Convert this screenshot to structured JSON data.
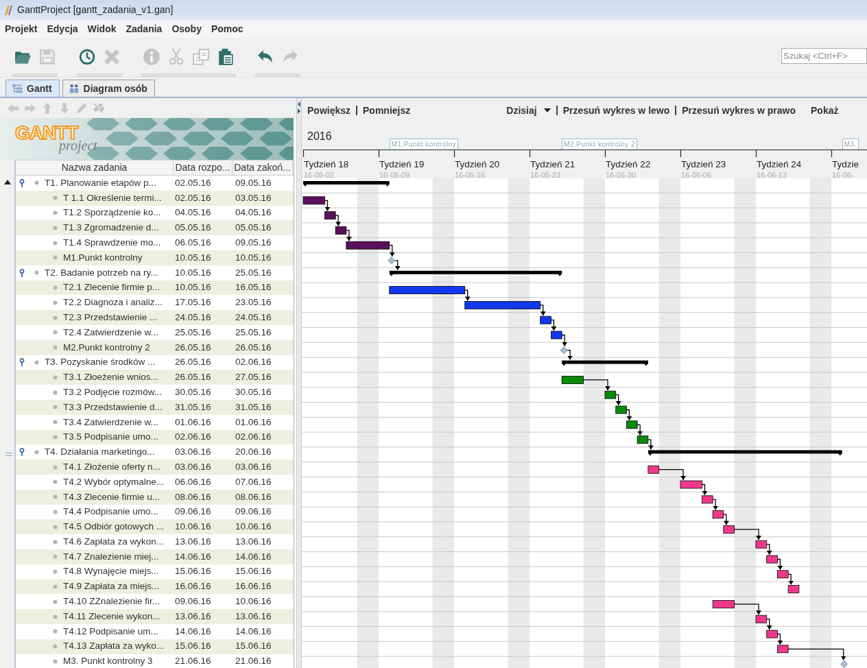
{
  "window": {
    "title": "GanttProject [gantt_zadania_v1.gan]"
  },
  "menu": [
    "Projekt",
    "Edycja",
    "Widok",
    "Zadania",
    "Osoby",
    "Pomoc"
  ],
  "toolbar": {
    "groups": [
      [
        {
          "disabled": false
        },
        {
          "disabled": true
        }
      ],
      [
        {
          "disabled": false
        },
        {
          "disabled": true
        }
      ],
      [
        {
          "disabled": true
        },
        {
          "disabled": true
        },
        {
          "disabled": true
        },
        {
          "disabled": false
        }
      ],
      [
        {
          "disabled": false
        },
        {
          "disabled": true
        }
      ]
    ]
  },
  "search": {
    "placeholder": "Szukaj <Ctrl+F>"
  },
  "tabs": [
    {
      "label": "Gantt",
      "selected": true
    },
    {
      "label": "Diagram osób",
      "selected": false
    }
  ],
  "task_nav": [
    {
      "disabled": true
    },
    {
      "disabled": true
    },
    {
      "disabled": true
    },
    {
      "disabled": true
    },
    {
      "disabled": true
    },
    {
      "disabled": true
    }
  ],
  "logo": {
    "title": "GANTT",
    "subtitle": "project"
  },
  "table": {
    "columns": [
      "Nazwa zadania",
      "Data rozpo...",
      "Data zakoń..."
    ],
    "tasks": [
      {
        "kind": "summary",
        "name": "T1. Planowanie etapów p...",
        "start": "02.05.16",
        "end": "09.05.16",
        "expanded": true,
        "linked": false,
        "children": [
          {
            "kind": "task",
            "name": "T 1.1 Określenie termi...",
            "start": "02.05.16",
            "end": "03.05.16",
            "color": "#5c0f5c",
            "linked": false
          },
          {
            "kind": "task",
            "name": "T1.2 Sporządzenie ko...",
            "start": "04.05.16",
            "end": "04.05.16",
            "color": "#5c0f5c",
            "linked": true
          },
          {
            "kind": "task",
            "name": "T1.3 Zgromadzenie d...",
            "start": "05.05.16",
            "end": "05.05.16",
            "color": "#5c0f5c",
            "linked": true
          },
          {
            "kind": "task",
            "name": "T1.4 Sprawdzenie mo...",
            "start": "06.05.16",
            "end": "09.05.16",
            "color": "#5c0f5c",
            "linked": true
          },
          {
            "kind": "milestone",
            "name": "M1.Punkt kontrolny",
            "start": "10.05.16",
            "end": "10.05.16",
            "linked": true
          }
        ]
      },
      {
        "kind": "summary",
        "name": "T2. Badanie potrzeb na ry...",
        "start": "10.05.16",
        "end": "25.05.16",
        "expanded": true,
        "linked": true,
        "children": [
          {
            "kind": "task",
            "name": "T2.1 Zlecenie firmie p...",
            "start": "10.05.16",
            "end": "16.05.16",
            "color": "#1038f0",
            "linked": false
          },
          {
            "kind": "task",
            "name": "T2.2 Diagnoza i analiz...",
            "start": "17.05.16",
            "end": "23.05.16",
            "color": "#1038f0",
            "linked": true
          },
          {
            "kind": "task",
            "name": "T2.3 Przedstawienie ...",
            "start": "24.05.16",
            "end": "24.05.16",
            "color": "#1038f0",
            "linked": true
          },
          {
            "kind": "task",
            "name": "T2.4 Zatwierdzenie w...",
            "start": "25.05.16",
            "end": "25.05.16",
            "color": "#1038f0",
            "linked": true
          },
          {
            "kind": "milestone",
            "name": "M2.Punkt kontrolny 2",
            "start": "26.05.16",
            "end": "26.05.16",
            "linked": true
          }
        ]
      },
      {
        "kind": "summary",
        "name": "T3. Pozyskanie środków ...",
        "start": "26.05.16",
        "end": "02.06.16",
        "expanded": true,
        "linked": true,
        "children": [
          {
            "kind": "task",
            "name": "T3.1 Złoeżenie wnios...",
            "start": "26.05.16",
            "end": "27.05.16",
            "color": "#0a8c0a",
            "linked": false
          },
          {
            "kind": "task",
            "name": "T3.2 Podjęcie rozmów...",
            "start": "30.05.16",
            "end": "30.05.16",
            "color": "#0a8c0a",
            "linked": true
          },
          {
            "kind": "task",
            "name": "T3.3 Przedstawienie d...",
            "start": "31.05.16",
            "end": "31.05.16",
            "color": "#0a8c0a",
            "linked": true
          },
          {
            "kind": "task",
            "name": "T3.4 Zatwierdzenie w...",
            "start": "01.06.16",
            "end": "01.06.16",
            "color": "#0a8c0a",
            "linked": true
          },
          {
            "kind": "task",
            "name": "T3.5 Podpisanie umo...",
            "start": "02.06.16",
            "end": "02.06.16",
            "color": "#0a8c0a",
            "linked": true
          }
        ]
      },
      {
        "kind": "summary",
        "name": "T4. Działania marketingo...",
        "start": "03.06.16",
        "end": "20.06.16",
        "expanded": true,
        "linked": true,
        "children": [
          {
            "kind": "task",
            "name": "T4.1 Złożenie oferty n...",
            "start": "03.06.16",
            "end": "03.06.16",
            "color": "#f0388c",
            "linked": false
          },
          {
            "kind": "task",
            "name": "T4.2 Wybór optymalne...",
            "start": "06.06.16",
            "end": "07.06.16",
            "color": "#f0388c",
            "linked": true
          },
          {
            "kind": "task",
            "name": "T4.3 Zlecenie firmie u...",
            "start": "08.06.16",
            "end": "08.06.16",
            "color": "#f0388c",
            "linked": true
          },
          {
            "kind": "task",
            "name": "T4.4 Podpisanie umo...",
            "start": "09.06.16",
            "end": "09.06.16",
            "color": "#f0388c",
            "linked": true
          },
          {
            "kind": "task",
            "name": "T4.5 Odbiór gotowych ...",
            "start": "10.06.16",
            "end": "10.06.16",
            "color": "#f0388c",
            "linked": true
          },
          {
            "kind": "task",
            "name": "T4.6 Zapłata za wykon...",
            "start": "13.06.16",
            "end": "13.06.16",
            "color": "#f0388c",
            "linked": true
          },
          {
            "kind": "task",
            "name": "T4.7 Znalezienie miej...",
            "start": "14.06.16",
            "end": "14.06.16",
            "color": "#f0388c",
            "linked": true
          },
          {
            "kind": "task",
            "name": "T4.8 Wynajęcie miejs...",
            "start": "15.06.16",
            "end": "15.06.16",
            "color": "#f0388c",
            "linked": true
          },
          {
            "kind": "task",
            "name": "T4.9 Zapłata za miejs...",
            "start": "16.06.16",
            "end": "16.06.16",
            "color": "#f0388c",
            "linked": true
          },
          {
            "kind": "task",
            "name": "T4.10 ZZnalezienie fir...",
            "start": "09.06.16",
            "end": "10.06.16",
            "color": "#f0388c",
            "linked": false
          },
          {
            "kind": "task",
            "name": "T4.11 Zlecenie  wykon...",
            "start": "13.06.16",
            "end": "13.06.16",
            "color": "#f0388c",
            "linked": true
          },
          {
            "kind": "task",
            "name": "T4.12 Podpisanie um...",
            "start": "14.06.16",
            "end": "14.06.16",
            "color": "#f0388c",
            "linked": true
          },
          {
            "kind": "task",
            "name": "T4.13 Zapłata za wyko...",
            "start": "15.06.16",
            "end": "15.06.16",
            "color": "#f0388c",
            "linked": true
          },
          {
            "kind": "milestone",
            "name": "M3. Punkt kontrolny 3",
            "start": "21.06.16",
            "end": "21.06.16",
            "linked": true
          }
        ]
      }
    ]
  },
  "chart": {
    "zoom_in": "Powiększ",
    "zoom_out": "Pomniejsz",
    "today": "Dzisiaj",
    "scroll_left": "Przesuń wykres w lewo",
    "scroll_right": "Przesuń wykres w prawo",
    "show": "Pokaż",
    "year": "2016",
    "milestone_labels": [
      "M1.Punkt kontrolny",
      "M2.Punkt kontrolny 2",
      "M3."
    ],
    "weeks": [
      {
        "label": "Tydzień 18",
        "date": "16-05-02"
      },
      {
        "label": "Tydzień 19",
        "date": "16-05-09"
      },
      {
        "label": "Tydzień 20",
        "date": "16-05-16"
      },
      {
        "label": "Tydzień 21",
        "date": "16-05-23"
      },
      {
        "label": "Tydzień 22",
        "date": "16-05-30"
      },
      {
        "label": "Tydzień 23",
        "date": "16-06-06"
      },
      {
        "label": "Tydzień 24",
        "date": "16-06-13"
      },
      {
        "label": "Tydzie",
        "date": "16-06-"
      }
    ]
  }
}
